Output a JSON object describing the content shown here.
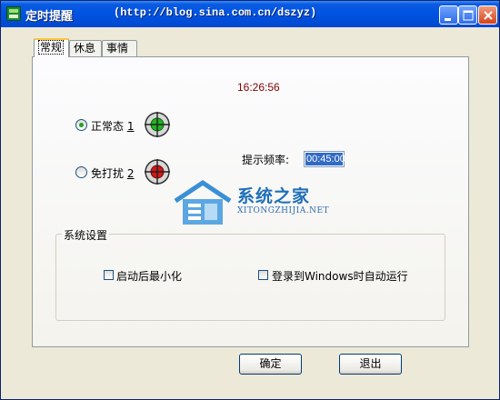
{
  "window": {
    "title": "定时提醒",
    "url": "(http://blog.sina.com.cn/dszyz)"
  },
  "tabs": [
    {
      "label": "常规",
      "active": true
    },
    {
      "label": "休息",
      "active": false
    },
    {
      "label": "事情",
      "active": false
    }
  ],
  "clock": "16:26:56",
  "modes": [
    {
      "label": "正常态",
      "key": "1",
      "selected": true,
      "target_color": "#1FB51F",
      "icon": "green-target-icon"
    },
    {
      "label": "免打扰",
      "key": "2",
      "selected": false,
      "target_color": "#D01818",
      "icon": "red-target-icon"
    }
  ],
  "frequency": {
    "label": "提示频率:",
    "value": "00:45:00"
  },
  "watermark": {
    "name": "系统之家",
    "domain": "XITONGZHIJIA.NET"
  },
  "settings": {
    "title": "系统设置",
    "options": [
      {
        "label": "启动后最小化",
        "checked": false
      },
      {
        "label": "登录到Windows时自动运行",
        "checked": false
      }
    ]
  },
  "buttons": {
    "ok": "确定",
    "exit": "退出"
  },
  "colors": {
    "titlebar": "#0054E3",
    "clock_text": "#800000",
    "selection": "#316AC5"
  }
}
